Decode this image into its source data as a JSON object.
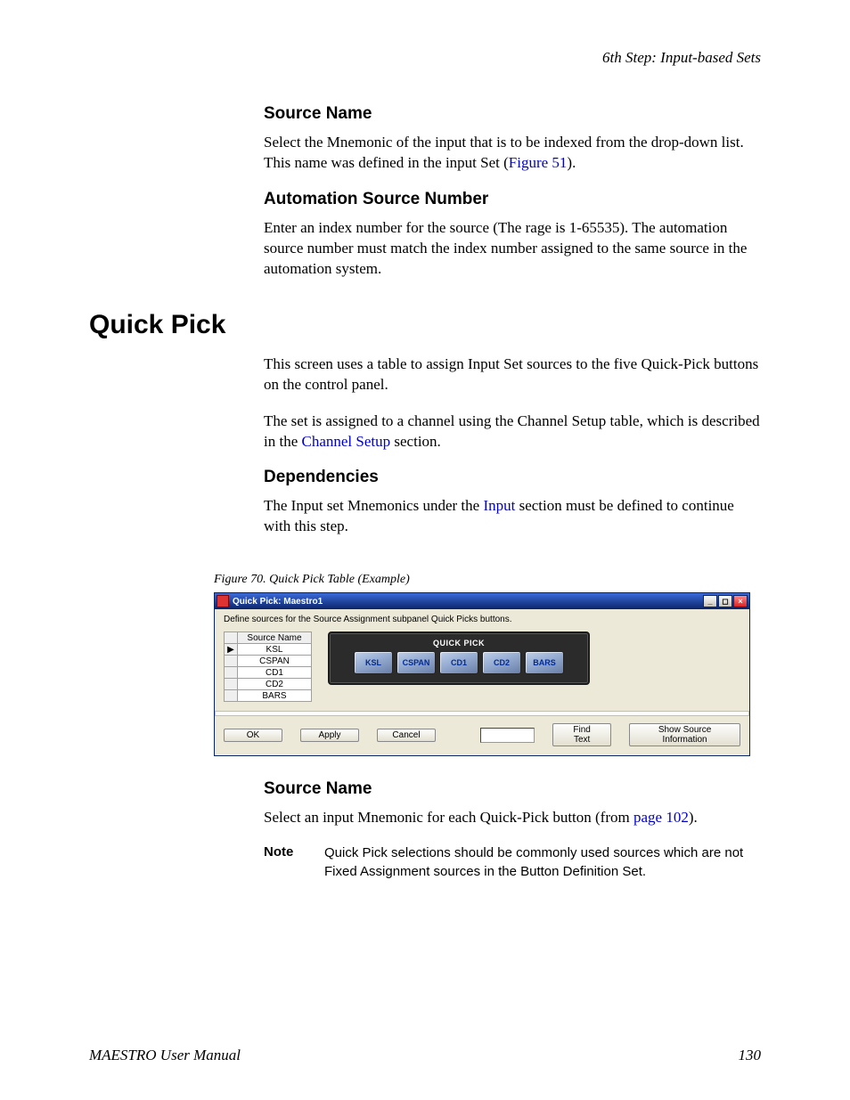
{
  "running_head": "6th Step: Input-based Sets",
  "sec1": {
    "title": "Source Name",
    "p1a": "Select the Mnemonic of the input that is to be indexed from the drop-down list. This name was defined in the input Set (",
    "p1link": "Figure 51",
    "p1b": ")."
  },
  "sec2": {
    "title": "Automation Source Number",
    "p": "Enter an index number for the source (The rage is 1-65535). The automation source number must match the index number assigned to the same source in the automation system."
  },
  "h1": "Quick Pick",
  "qp_intro": {
    "p1": "This screen uses a table to assign Input Set sources to the five Quick-Pick buttons on the control panel.",
    "p2a": "The set is assigned to a channel using the Channel Setup table, which is described in the ",
    "p2link": "Channel Setup",
    "p2b": " section."
  },
  "dep": {
    "title": "Dependencies",
    "p_a": "The Input set Mnemonics under the ",
    "p_link": "Input",
    "p_b": " section must be defined to continue with this step."
  },
  "fig_caption": "Figure 70.  Quick Pick Table (Example)",
  "window": {
    "title": "Quick Pick: Maestro1",
    "instruction": "Define sources for the Source Assignment subpanel Quick Picks buttons.",
    "grid_header": "Source Name",
    "rows": [
      "KSL",
      "CSPAN",
      "CD1",
      "CD2",
      "BARS"
    ],
    "qp_label": "QUICK PICK",
    "qp_buttons": [
      "KSL",
      "CSPAN",
      "CD1",
      "CD2",
      "BARS"
    ],
    "btn_ok": "OK",
    "btn_apply": "Apply",
    "btn_cancel": "Cancel",
    "btn_find": "Find Text",
    "btn_show": "Show Source Information"
  },
  "sec3": {
    "title": "Source Name",
    "p_a": "Select an input Mnemonic for each Quick-Pick button (from ",
    "p_link": "page 102",
    "p_b": ")."
  },
  "note": {
    "label": "Note",
    "body": "Quick Pick selections should be commonly used sources which are not Fixed Assignment sources in the Button Definition Set."
  },
  "footer": {
    "left": "MAESTRO User Manual",
    "right": "130"
  }
}
